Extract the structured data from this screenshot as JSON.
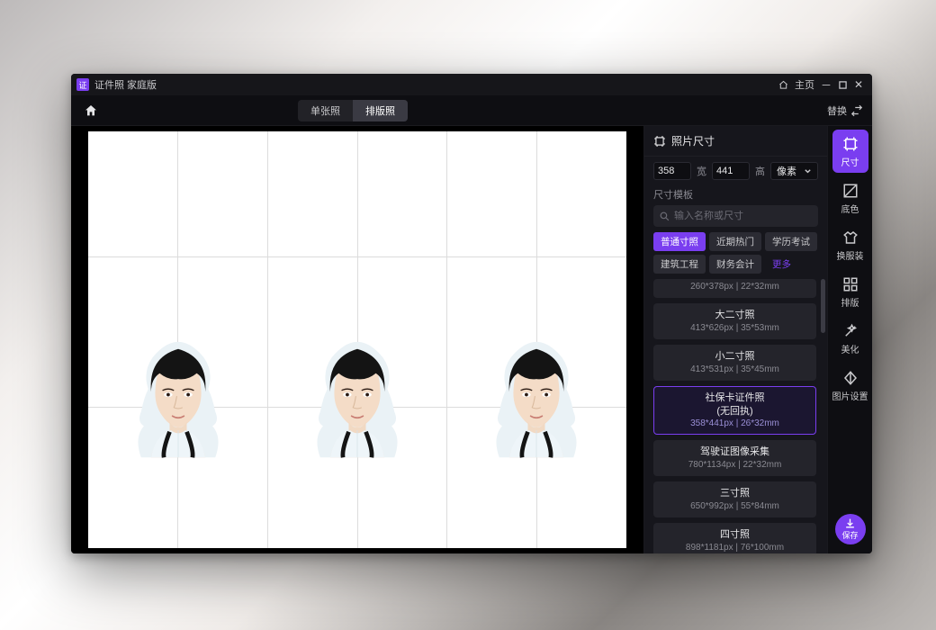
{
  "title": "证件照 家庭版",
  "titlebar": {
    "home_label": "主页"
  },
  "toolbar": {
    "home_name": "home",
    "segment": {
      "single": "单张照",
      "layout": "排版照"
    },
    "replace": "替换"
  },
  "panel": {
    "header": "照片尺寸",
    "width_value": "358",
    "width_label": "宽",
    "height_value": "441",
    "height_label": "高",
    "unit": "像素",
    "template_label": "尺寸模板",
    "search_placeholder": "输入名称或尺寸",
    "categories": [
      {
        "label": "普通寸照",
        "active": true
      },
      {
        "label": "近期热门"
      },
      {
        "label": "学历考试"
      },
      {
        "label": "建筑工程"
      },
      {
        "label": "财务会计"
      },
      {
        "label": "更多",
        "more": true
      }
    ],
    "items": [
      {
        "title": "",
        "sub": "260*378px | 22*32mm",
        "cut_top": true
      },
      {
        "title": "大二寸照",
        "sub": "413*626px | 35*53mm"
      },
      {
        "title": "小二寸照",
        "sub": "413*531px | 35*45mm"
      },
      {
        "title": "社保卡证件照\n(无回执)",
        "sub": "358*441px | 26*32mm",
        "selected": true
      },
      {
        "title": "驾驶证图像采集",
        "sub": "780*1134px | 22*32mm"
      },
      {
        "title": "三寸照",
        "sub": "650*992px | 55*84mm"
      },
      {
        "title": "四寸照",
        "sub": "898*1181px | 76*100mm"
      }
    ]
  },
  "rail": {
    "items": [
      {
        "name": "size",
        "label": "尺寸",
        "active": true
      },
      {
        "name": "background",
        "label": "底色"
      },
      {
        "name": "clothes",
        "label": "换服装"
      },
      {
        "name": "layout",
        "label": "排版"
      },
      {
        "name": "beautify",
        "label": "美化"
      },
      {
        "name": "image-settings",
        "label": "图片设置"
      }
    ],
    "save": "保存"
  },
  "colors": {
    "accent": "#7a3ef0"
  }
}
